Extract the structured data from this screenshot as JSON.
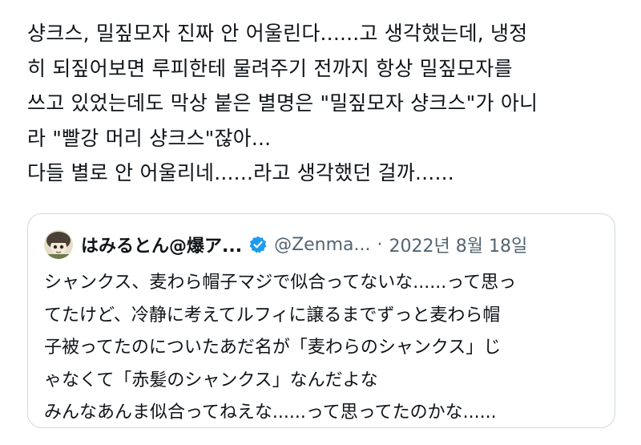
{
  "post": {
    "text_lines": [
      "샹크스, 밀짚모자 진짜 안 어울린다......고 생각했는데, 냉정",
      "히 되짚어보면 루피한테 물려주기 전까지 항상 밀짚모자를",
      "쓰고 있었는데도 막상 붙은 별명은 \"밀짚모자 샹크스\"가 아니",
      "라 \"빨강 머리 샹크스\"잖아...",
      "다들 별로 안 어울리네......라고 생각했던 걸까......"
    ]
  },
  "quoted_post": {
    "author_name": "はみるとん@爆ア...",
    "author_handle": "@Zenma...",
    "separator": "·",
    "date": "2022년 8월 18일",
    "icons": {
      "avatar": "avatar-icon",
      "verified": "verified-badge-icon"
    },
    "verified_color": "#1d9bf0",
    "text_lines": [
      "シャンクス、麦わら帽子マジで似合ってないな......って思っ",
      "てたけど、冷静に考えてルフィに譲るまでずっと麦わら帽",
      "子被ってたのについたあだ名が「麦わらのシャンクス」じ",
      "ゃなくて「赤髪のシャンクス」なんだよな",
      "みんなあんま似合ってねえな......って思ってたのかな......"
    ]
  }
}
